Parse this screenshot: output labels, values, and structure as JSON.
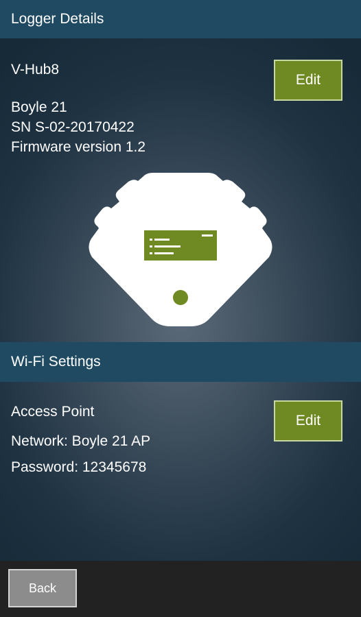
{
  "logger": {
    "header": "Logger Details",
    "device_type": "V-Hub8",
    "name": "Boyle 21",
    "serial": "SN S-02-20170422",
    "firmware": "Firmware version 1.2",
    "edit_label": "Edit"
  },
  "wifi": {
    "header": "Wi-Fi Settings",
    "mode": "Access Point",
    "network": "Network: Boyle 21 AP",
    "password": "Password: 12345678",
    "edit_label": "Edit"
  },
  "footer": {
    "back_label": "Back"
  },
  "colors": {
    "header_bg": "#1f4a62",
    "accent_green": "#6f8a22",
    "bottom_bar": "#222222",
    "back_button": "#8c8c8c"
  },
  "icons": {
    "device": "v-hub-device-icon"
  }
}
